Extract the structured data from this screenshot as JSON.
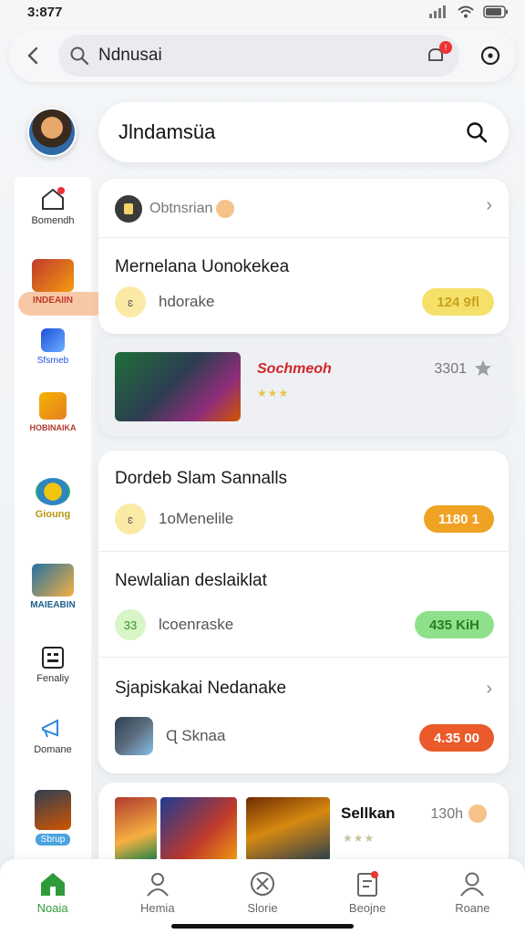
{
  "status": {
    "time": "3:877"
  },
  "search": {
    "query": "Ndnusai",
    "notif_count": "!"
  },
  "secondary_search": {
    "query": "Jlndamsüa"
  },
  "sidebar": {
    "items": [
      {
        "label": "Bomendh"
      },
      {
        "label": "INDEAIIN"
      },
      {
        "label": "Sfsrneb"
      },
      {
        "label": "HOBINAIKA"
      },
      {
        "label": "Gioung"
      },
      {
        "label": "MAIEABIN"
      },
      {
        "label": "Fenaliy"
      },
      {
        "label": "Domane"
      },
      {
        "label": "Sbrup"
      }
    ]
  },
  "header_card": {
    "label": "Obtnsrian",
    "title": "Mernelana Uonokekea",
    "sub": "hdorake",
    "sub_icon": "ɛ",
    "pill": "124 9fl"
  },
  "featured": {
    "title": "Sochmeoh",
    "count": "3301",
    "stars": "★★★"
  },
  "list_card": {
    "rows": [
      {
        "title": "Dordeb Slam Sannalls",
        "sub": "1oMenelile",
        "icon": "ɛ",
        "pill": "1180 1"
      },
      {
        "title": "Newlalian deslaiklat",
        "sub": "lcoenraske",
        "icon": "33",
        "pill": "435 KiH"
      },
      {
        "title": "Sjapiskakai Nedanake",
        "sub": "Ɋ Sknaa",
        "icon": "",
        "pill": "4.35 00"
      }
    ]
  },
  "bottom_card": {
    "title": "Sellkan",
    "count": "130h",
    "stars": "★★★"
  },
  "nav": {
    "items": [
      {
        "label": "Noaia"
      },
      {
        "label": "Hemia"
      },
      {
        "label": "Slorie"
      },
      {
        "label": "Beojne"
      },
      {
        "label": "Roane"
      }
    ]
  },
  "colors": {
    "accent_green": "#2e9b3a",
    "pill_yellow": "#f5e06a",
    "pill_orange": "#f0a224",
    "pill_green": "#8fe08a",
    "pill_red": "#ea5a2a"
  }
}
